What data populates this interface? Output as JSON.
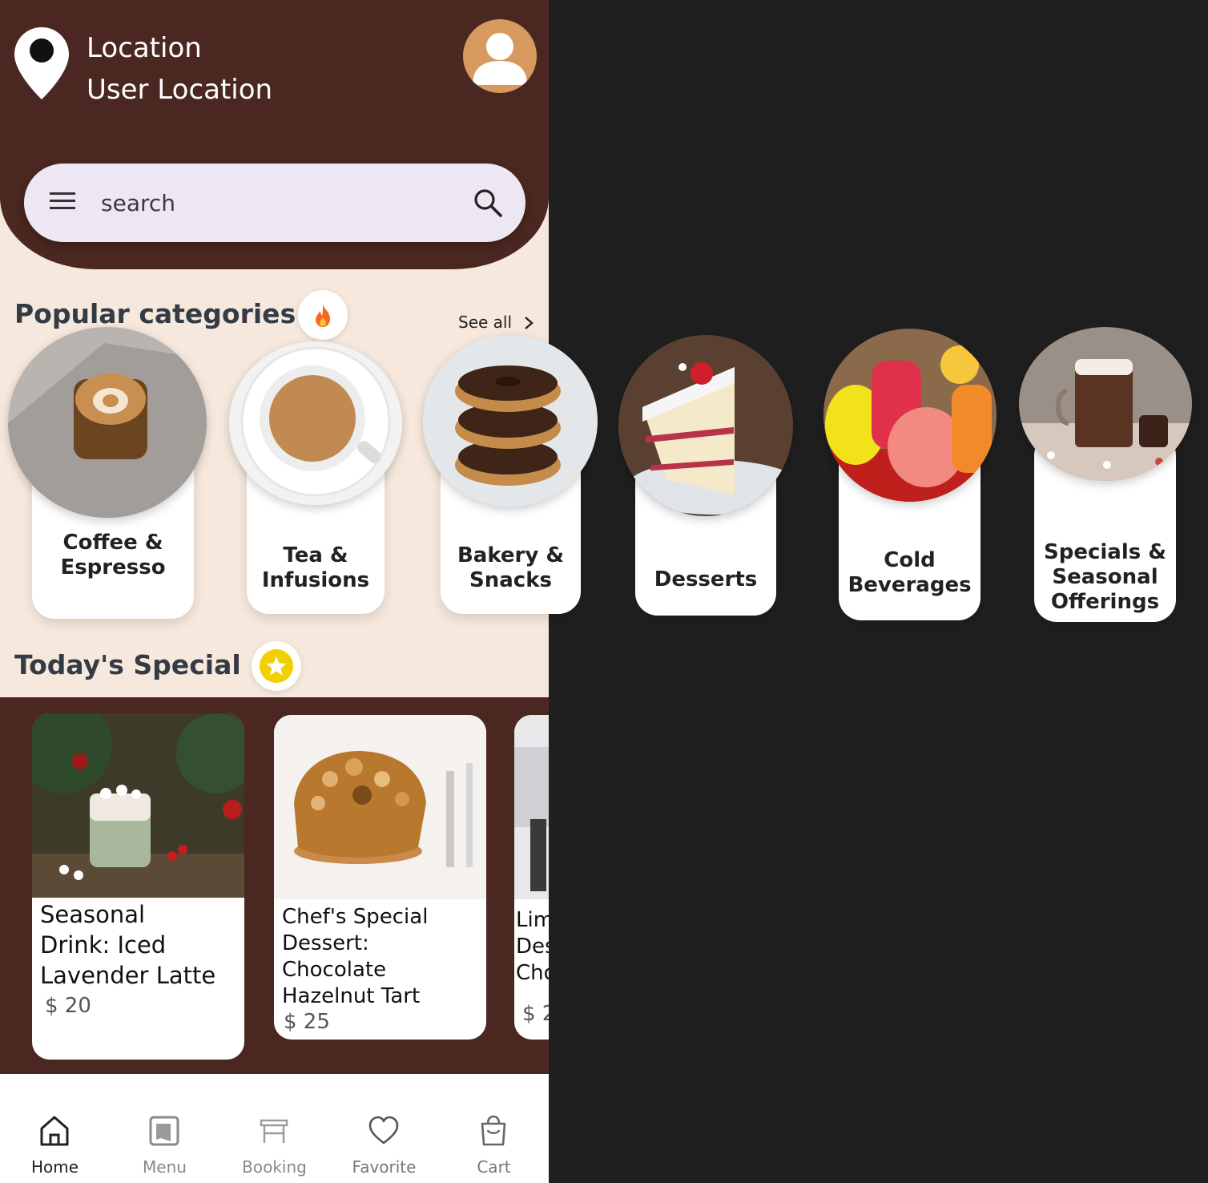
{
  "header": {
    "location_label": "Location",
    "location_value": "User Location"
  },
  "search": {
    "placeholder": "search"
  },
  "popular": {
    "title": "Popular categories",
    "see_all": "See all",
    "categories": [
      {
        "label": "Coffee &\nEspresso"
      },
      {
        "label": "Tea &\nInfusions"
      },
      {
        "label": "Bakery &\nSnacks"
      },
      {
        "label": "Desserts"
      },
      {
        "label": "Cold\nBeverages"
      },
      {
        "label": "Specials &\nSeasonal\nOfferings"
      }
    ]
  },
  "special": {
    "title": "Today's Special",
    "items": [
      {
        "name": "Seasonal\nDrink: Iced\nLavender Latte",
        "price": "$ 20"
      },
      {
        "name": "Chef's Special\nDessert:\nChocolate\nHazelnut Tart",
        "price": "$ 25"
      },
      {
        "name": "Lim\nDes\nCho",
        "price": "$ 2"
      }
    ]
  },
  "nav": {
    "items": [
      {
        "label": "Home",
        "active": true
      },
      {
        "label": "Menu",
        "active": false
      },
      {
        "label": "Booking",
        "active": false
      },
      {
        "label": "Favorite",
        "active": false
      },
      {
        "label": "Cart",
        "active": false
      }
    ]
  },
  "colors": {
    "brand_brown": "#4a2720",
    "background_cream": "#f6e8dc",
    "outside_dark": "#1f1f1f",
    "star_yellow": "#f0d000",
    "avatar_orange": "#d69a5e"
  },
  "icons": {
    "location": "location-pin-icon",
    "profile": "user-avatar-icon",
    "menu": "hamburger-menu-icon",
    "search": "search-icon",
    "popular_badge": "fire-icon",
    "special_badge": "star-icon",
    "see_all": "chevron-right-icon",
    "nav": [
      "home-icon",
      "menu-book-icon",
      "booking-table-icon",
      "heart-icon",
      "shopping-bag-icon"
    ]
  }
}
